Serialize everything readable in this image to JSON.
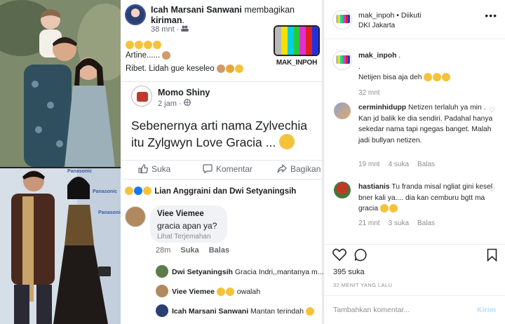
{
  "left_photos": {
    "sponsor_text": "Panasonic"
  },
  "facebook": {
    "post": {
      "author": "Icah Marsani Sanwani",
      "action": "membagikan",
      "object": "kiriman",
      "time": "38 mnt",
      "line1": "Artine......",
      "line2": "Ribet. Lidah gue keseleo"
    },
    "watermark": "MAK_INPOH",
    "shared": {
      "author": "Momo Shiny",
      "time": "2 jam",
      "text": "Sebenernya arti nama Zylvechia itu Zylgwyn Love Gracia ..."
    },
    "actions": {
      "like": "Suka",
      "comment": "Komentar",
      "share": "Bagikan"
    },
    "reactions_text": "Lian Anggraini dan Dwi Setyaningsih",
    "comment": {
      "author": "Viee Viemee",
      "text": "gracia apan ya?",
      "translate": "Lihat Terjemahan",
      "time": "28m",
      "like": "Suka",
      "reply": "Balas"
    },
    "replies": [
      {
        "author": "Dwi Setyaningsih",
        "text": "Gracia Indri,,mantanya m..."
      },
      {
        "author": "Viee Viemee",
        "text": "owalah"
      },
      {
        "author": "Icah Marsani Sanwani",
        "text": "Mantan terindah"
      }
    ]
  },
  "instagram": {
    "username": "mak_inpoh",
    "follow_status": "Diikuti",
    "location": "DKI Jakarta",
    "caption": {
      "username": "mak_inpoh",
      "line1": ".",
      "line2": ".",
      "line3": "Netijen bisa aja deh",
      "time": "32 mnt"
    },
    "comments": [
      {
        "username": "cerminhidupp",
        "text": "Netizen terlaluh ya min . Kan jd balik ke dia sendiri. Padahal hanya sekedar nama tapi ngegas banget. Malah jadi bullyan netizen.",
        "time": "19 mnt",
        "likes": "4 suka",
        "reply": "Balas"
      },
      {
        "username": "hastianis",
        "text": "Tu franda misal ngliat gini kesel bner kali ya.... dia kan cemburu bgtt ma gracia",
        "time": "21 mnt",
        "likes": "3 suka",
        "reply": "Balas"
      }
    ],
    "likes_count": "395 suka",
    "posted_ago": "32 MENIT YANG LALU",
    "input_placeholder": "Tambahkan komentar...",
    "post_button": "Kirim"
  },
  "colors": {
    "fb_blue": "#3b5998",
    "ig_text": "#262626",
    "ig_muted": "#8e8e8e",
    "ig_post_disabled": "#b2dffc"
  }
}
